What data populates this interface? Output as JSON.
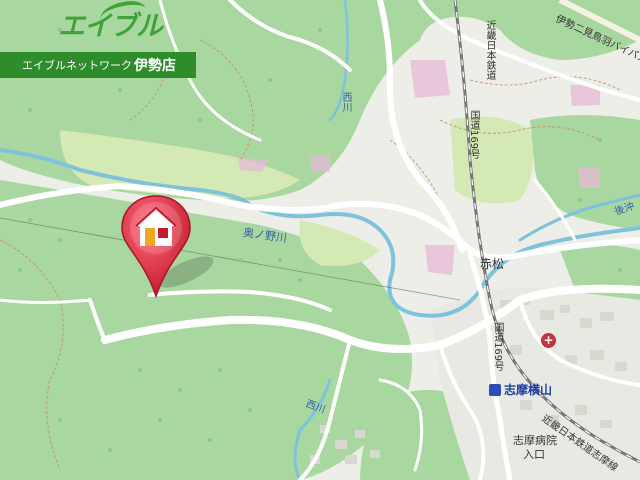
{
  "brand": {
    "logo_text": "エイブル",
    "network_label": "エイブルネットワーク",
    "shop_name": "伊勢店",
    "color": "#2e8d2a"
  },
  "pin": {
    "icon": "home-icon",
    "color": "#d7263d"
  },
  "labels": {
    "river_okunoino": "奥ノ野川",
    "river_nishikawa_top": "西川",
    "river_nishikawa_bottom": "西川",
    "river_east": "後沖",
    "route_169_top": "国道169号",
    "route_169_bottom": "国道169号",
    "rail_top": "近畿日本鉄道",
    "rail_bottom": "近畿日本鉄道志摩線",
    "bypass": "伊勢二見鳥羽バイパス",
    "akamatsu": "赤松",
    "station": "志摩横山",
    "hospital_entrance_line1": "志摩病院",
    "hospital_entrance_line2": "入口",
    "hospital_symbol": "+"
  },
  "colors": {
    "forest": "#a9d7a0",
    "residential": "#e8e8e2",
    "river": "#7fc2dc",
    "road": "#ffffff",
    "pink": "#e8b9d6",
    "rail": "#6b6b6b"
  }
}
